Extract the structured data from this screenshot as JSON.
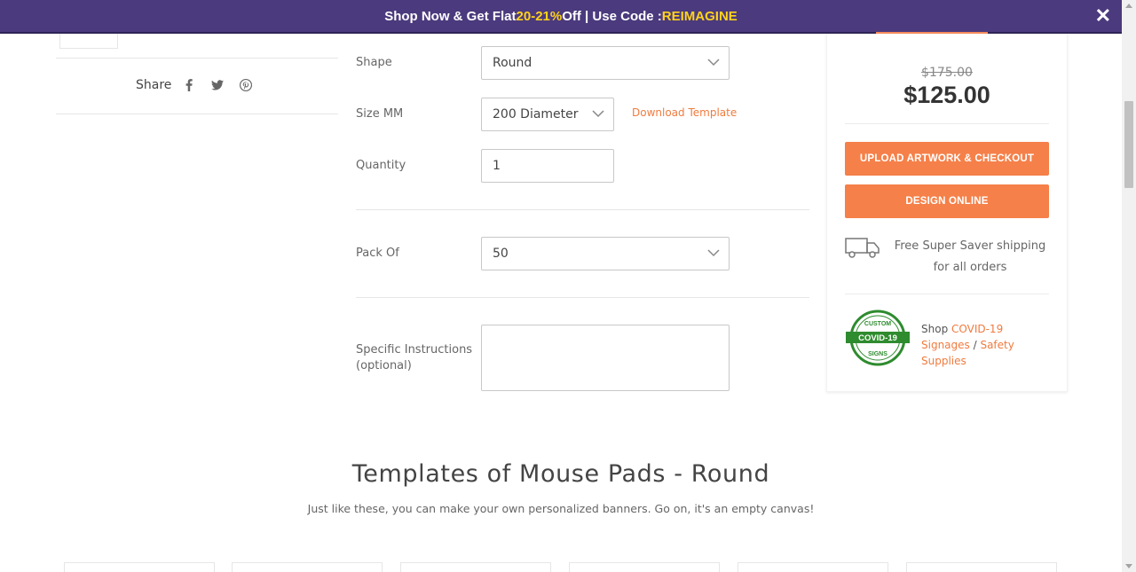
{
  "promo": {
    "text_before": "Shop Now & Get Flat ",
    "discount": "20-21%",
    "text_middle": " Off | Use Code : ",
    "code": "REIMAGINE",
    "close_glyph": "✕"
  },
  "share": {
    "label": "Share",
    "icons": [
      "facebook-icon",
      "twitter-icon",
      "pinterest-icon"
    ]
  },
  "form": {
    "shape_label": "Shape",
    "shape_value": "Round",
    "size_label": "Size MM",
    "size_value": "200 Diameter",
    "download_template": "Download Template",
    "quantity_label": "Quantity",
    "quantity_value": "1",
    "pack_label": "Pack Of",
    "pack_value": "50",
    "instructions_label_line1": "Specific Instructions",
    "instructions_label_line2": "(optional)",
    "instructions_value": ""
  },
  "price_card": {
    "old_price": "$175.00",
    "new_price": "$125.00",
    "upload_button": "UPLOAD ARTWORK & CHECKOUT",
    "design_button": "DESIGN ONLINE",
    "shipping_text": "Free Super Saver shipping for all orders",
    "covid_badge": {
      "top": "CUSTOM",
      "middle": "COVID-19",
      "bottom": "SIGNS"
    },
    "covid_prefix": "Shop ",
    "covid_link": "COVID-19 Signages",
    "covid_sep": " / ",
    "safety_link": "Safety Supplies"
  },
  "templates": {
    "title": "Templates of Mouse Pads - Round",
    "subtitle": "Just like these, you can make your own personalized banners. Go on, it's an empty canvas!"
  },
  "colors": {
    "promo_bg": "#4b3a7d",
    "promo_highlight": "#ffd31a",
    "accent_orange": "#f58049",
    "link_orange": "#f07b3f",
    "badge_green": "#2e8b2e"
  }
}
